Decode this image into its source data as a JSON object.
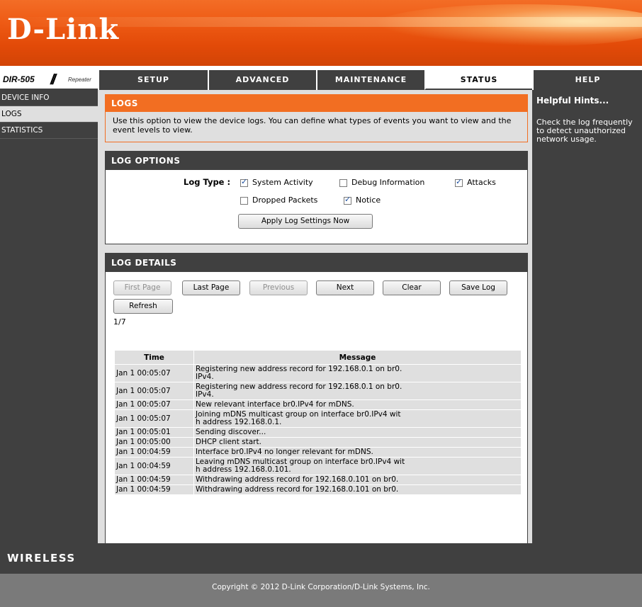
{
  "brand": {
    "logo": "D-Link",
    "model": "DIR-505",
    "mode": "Repeater"
  },
  "nav": {
    "tabs": [
      {
        "label": "SETUP"
      },
      {
        "label": "ADVANCED"
      },
      {
        "label": "MAINTENANCE"
      },
      {
        "label": "STATUS"
      },
      {
        "label": "HELP"
      }
    ],
    "active": "STATUS"
  },
  "sidebar": {
    "items": [
      {
        "label": "DEVICE INFO"
      },
      {
        "label": "LOGS"
      },
      {
        "label": "STATISTICS"
      }
    ],
    "active": "LOGS"
  },
  "logs": {
    "title": "LOGS",
    "description": "Use this option to view the device logs. You can define what types of events you want to view and the event levels to view."
  },
  "log_options": {
    "title": "LOG OPTIONS",
    "log_type_label": "Log Type :",
    "options": [
      {
        "label": "System Activity",
        "checked": true
      },
      {
        "label": "Debug Information",
        "checked": false
      },
      {
        "label": "Attacks",
        "checked": true
      },
      {
        "label": "Dropped Packets",
        "checked": false
      },
      {
        "label": "Notice",
        "checked": true
      }
    ],
    "apply_label": "Apply Log Settings Now"
  },
  "log_details": {
    "title": "LOG DETAILS",
    "buttons": {
      "first_page": "First Page",
      "last_page": "Last Page",
      "previous": "Previous",
      "next": "Next",
      "clear": "Clear",
      "save_log": "Save Log",
      "refresh": "Refresh"
    },
    "page_indicator": "1/7",
    "columns": {
      "time": "Time",
      "message": "Message"
    },
    "rows": [
      {
        "time": "Jan 1 00:05:07",
        "message": "Registering new address record for 192.168.0.1 on br0.\nIPv4."
      },
      {
        "time": "Jan 1 00:05:07",
        "message": "Registering new address record for 192.168.0.1 on br0.\nIPv4."
      },
      {
        "time": "Jan 1 00:05:07",
        "message": "New relevant interface br0.IPv4 for mDNS."
      },
      {
        "time": "Jan 1 00:05:07",
        "message": "Joining mDNS multicast group on interface br0.IPv4 wit\nh address 192.168.0.1."
      },
      {
        "time": "Jan 1 00:05:01",
        "message": "Sending discover..."
      },
      {
        "time": "Jan 1 00:05:00",
        "message": "DHCP client start."
      },
      {
        "time": "Jan 1 00:04:59",
        "message": "Interface br0.IPv4 no longer relevant for mDNS."
      },
      {
        "time": "Jan 1 00:04:59",
        "message": "Leaving mDNS multicast group on interface br0.IPv4 wit\nh address 192.168.0.101."
      },
      {
        "time": "Jan 1 00:04:59",
        "message": "Withdrawing address record for 192.168.0.101 on br0."
      },
      {
        "time": "Jan 1 00:04:59",
        "message": "Withdrawing address record for 192.168.0.101 on br0."
      }
    ]
  },
  "hints": {
    "title": "Helpful Hints...",
    "text": "Check the log frequently to detect unauthorized network usage."
  },
  "footer": {
    "wireless": "WIRELESS",
    "copyright": "Copyright © 2012 D-Link Corporation/D-Link Systems, Inc."
  },
  "colors": {
    "orange": "#f26e22",
    "dark": "#404040",
    "light": "#dfdfdf",
    "footer": "#7a7a7a"
  }
}
